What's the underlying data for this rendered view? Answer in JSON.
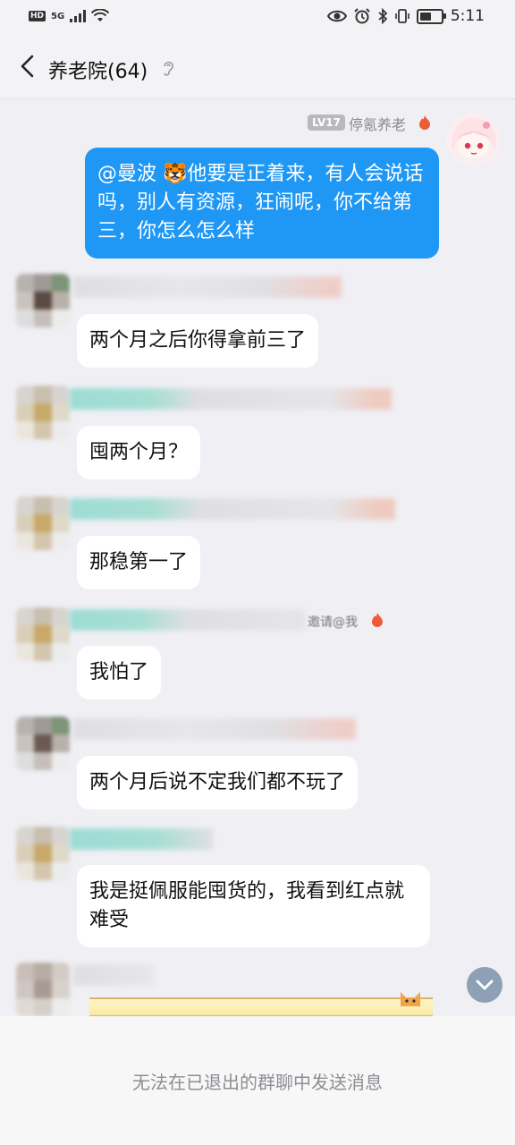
{
  "status_bar": {
    "hd": "HD",
    "network": "5G",
    "time": "5:11",
    "battery_level": 0.55
  },
  "header": {
    "title": "养老院(64)"
  },
  "my_message": {
    "level": "LV17",
    "sender": "停氪养老",
    "text": "@曼波 🐯他要是正着来，有人会说话吗，别人有资源，狂闹呢，你不给第三，你怎么怎么样"
  },
  "messages": [
    {
      "text": "两个月之后你得拿前三了"
    },
    {
      "text": "囤两个月？"
    },
    {
      "text": "那稳第一了"
    },
    {
      "text": "我怕了",
      "tag": "邀请@我"
    },
    {
      "text": "两个月后说不定我们都不玩了"
    },
    {
      "text": "我是挺佩服能囤货的，我看到红点就难受"
    }
  ],
  "footer": {
    "notice": "无法在已退出的群聊中发送消息"
  },
  "colors": {
    "accent": "#1e97f5",
    "background": "#efeff4",
    "flame": "#ee5b36"
  },
  "icons": [
    "back-arrow-icon",
    "ear-icon",
    "flame-icon",
    "chevron-down-icon",
    "wifi-icon",
    "eye-icon",
    "alarm-icon",
    "bluetooth-icon",
    "vibrate-icon",
    "battery-icon"
  ]
}
